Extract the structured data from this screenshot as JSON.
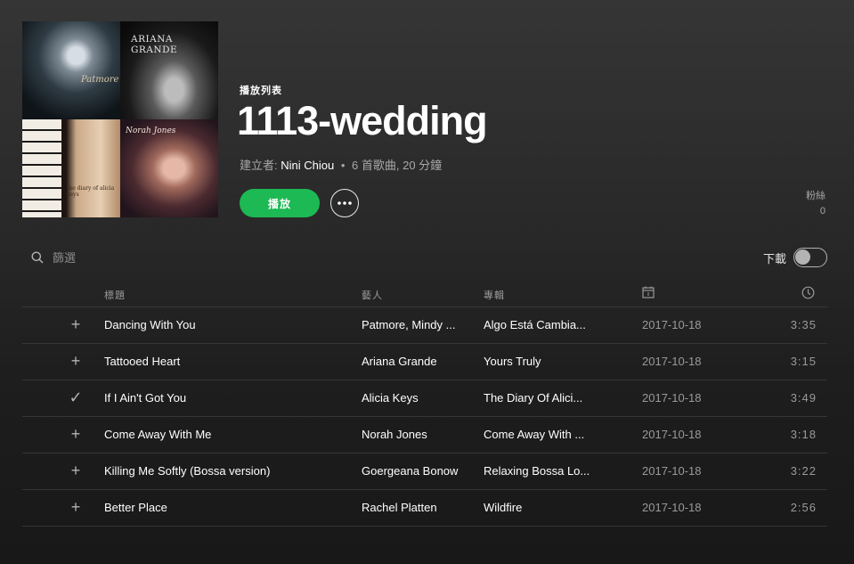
{
  "cover": {
    "tiles": [
      {
        "text": "Patmore"
      },
      {
        "text": "ARIANA GRANDE"
      },
      {
        "text": "the diary of alicia keys"
      },
      {
        "text": "Norah Jones"
      }
    ]
  },
  "playlist": {
    "type_label": "播放列表",
    "title": "1113-wedding",
    "meta_prefix": "建立者:",
    "owner": "Nini Chiou",
    "separator": "•",
    "summary": "6 首歌曲, 20 分鐘"
  },
  "actions": {
    "play_label": "播放",
    "more_icon": "more-horizontal-icon"
  },
  "followers": {
    "label": "粉絲",
    "count": "0"
  },
  "filter": {
    "placeholder": "篩選",
    "icon": "search-icon"
  },
  "download": {
    "label": "下載",
    "enabled": false
  },
  "table": {
    "headers": {
      "title": "標題",
      "artist": "藝人",
      "album": "專輯",
      "date_icon": "calendar-icon",
      "duration_icon": "clock-icon"
    },
    "rows": [
      {
        "state": "+",
        "title": "Dancing With You",
        "artist": "Patmore, Mindy ...",
        "album": "Algo Está Cambia...",
        "date": "2017-10-18",
        "duration": "3:35"
      },
      {
        "state": "+",
        "title": "Tattooed Heart",
        "artist": "Ariana Grande",
        "album": "Yours Truly",
        "date": "2017-10-18",
        "duration": "3:15"
      },
      {
        "state": "✓",
        "title": "If I Ain't Got You",
        "artist": "Alicia Keys",
        "album": "The Diary Of Alici...",
        "date": "2017-10-18",
        "duration": "3:49"
      },
      {
        "state": "+",
        "title": "Come Away With Me",
        "artist": "Norah Jones",
        "album": "Come Away With ...",
        "date": "2017-10-18",
        "duration": "3:18"
      },
      {
        "state": "+",
        "title": "Killing Me Softly (Bossa version)",
        "artist": "Goergeana Bonow",
        "album": "Relaxing Bossa Lo...",
        "date": "2017-10-18",
        "duration": "3:22"
      },
      {
        "state": "+",
        "title": "Better Place",
        "artist": "Rachel Platten",
        "album": "Wildfire",
        "date": "2017-10-18",
        "duration": "2:56"
      }
    ]
  },
  "colors": {
    "accent": "#1db954",
    "text_secondary": "#a8a8a8"
  }
}
